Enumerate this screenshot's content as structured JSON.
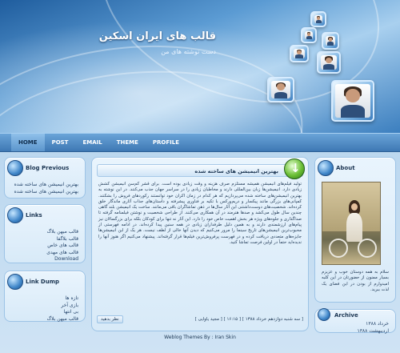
{
  "header": {
    "title": "قالب های ایران اسکین",
    "tagline": "دست نوشته های من"
  },
  "nav": {
    "items": [
      "HOME",
      "POST",
      "EMAIL",
      "THEME",
      "PROFILE"
    ]
  },
  "blog_previous": {
    "title": "Blog Previous",
    "items": [
      "بهترین انیمیشن های ساخته شده",
      "بهترین انیمیشن های ساخته شده"
    ]
  },
  "links": {
    "title": "Links",
    "items": [
      "قالب میهن بلاگ",
      "قالب بلاگفا",
      "قالب های خاص",
      "قالب های مهدی",
      "Download"
    ]
  },
  "link_dump": {
    "title": "Link Dump",
    "items": [
      "تازه ها",
      "بازی آخر",
      "بی انتها",
      "قالب میهن بلاگ"
    ]
  },
  "post": {
    "title": "بهترین انیمیشن های ساخته شده",
    "body": "تولید فیلم‌های انیمیشن همیشه مستلزم صرف هزینه و وقت زیادی بوده است. برای قشر کم‌سن انیمیشن کشش زیادی دارد. انیمیشن‌ها زبان بین‌المللی دارند و مخاطبان زیادی را در سراسر جهان جذب می‌کنند. در این نوشته به بهترین انیمیشن‌های ساخته شده می‌پردازیم که هر کدام در زمان اکران خود توانستند رکوردهای فروش را بشکنند. کمپانی‌های بزرگی مانند پیکسار و دریم‌ورکس با تکیه بر فناوری پیشرفته و داستان‌های جذاب آثاری ماندگار خلق کرده‌اند. شخصیت‌های دوست‌داشتنی این آثار سال‌ها در ذهن تماشاگران باقی می‌مانند. ساخت یک انیمیشن بلند گاهی چندین سال طول می‌کشد و صدها هنرمند در آن همکاری می‌کنند. از طراحی شخصیت و نوشتن فیلمنامه گرفته تا صداگذاری و جلوه‌های ویژه هر بخش اهمیت خاص خود را دارد. این آثار نه تنها برای کودکان بلکه برای بزرگسالان نیز پیام‌های ارزشمندی دارند و به همین دلیل طرفداران زیادی در همه سنین پیدا کرده‌اند. در ادامه فهرستی از محبوب‌ترین انیمیشن‌های تاریخ سینما را مرور می‌کنیم که دیدن آنها خالی از لطف نیست. هر یک از این انیمیشن‌ها جایزه‌های متعددی دریافت کرده و در فهرست پرفروش‌ترین فیلم‌ها قرار گرفته‌اند. پیشنهاد می‌کنیم اگر هنوز آنها را ندیده‌اید حتماً در اولین فرصت تماشا کنید.",
    "footer_links": "[ سه شنبه دوازدهم خرداد ۱۳۸۸ ] [ ۱۶:۱۵ ] [ مجید یاوایی ]",
    "comment": "نظر بدهید"
  },
  "about": {
    "title": "About",
    "text": "سلام به همه دوستان خوب و عزیزم بسیار ممنون از حضورتان در این کلبه امیدوارم از بودن در این فضای یک لذت ببرید."
  },
  "archive": {
    "title": "Archive",
    "items": [
      "خرداد ۱۳۸۸",
      "اردیبهشت ۱۳۸۸"
    ]
  },
  "footer": {
    "credit": "Weblog Themes By : Iran Skin"
  },
  "colors": {
    "accent": "#3e78b4",
    "panel_bg": "#e9f4fd"
  }
}
